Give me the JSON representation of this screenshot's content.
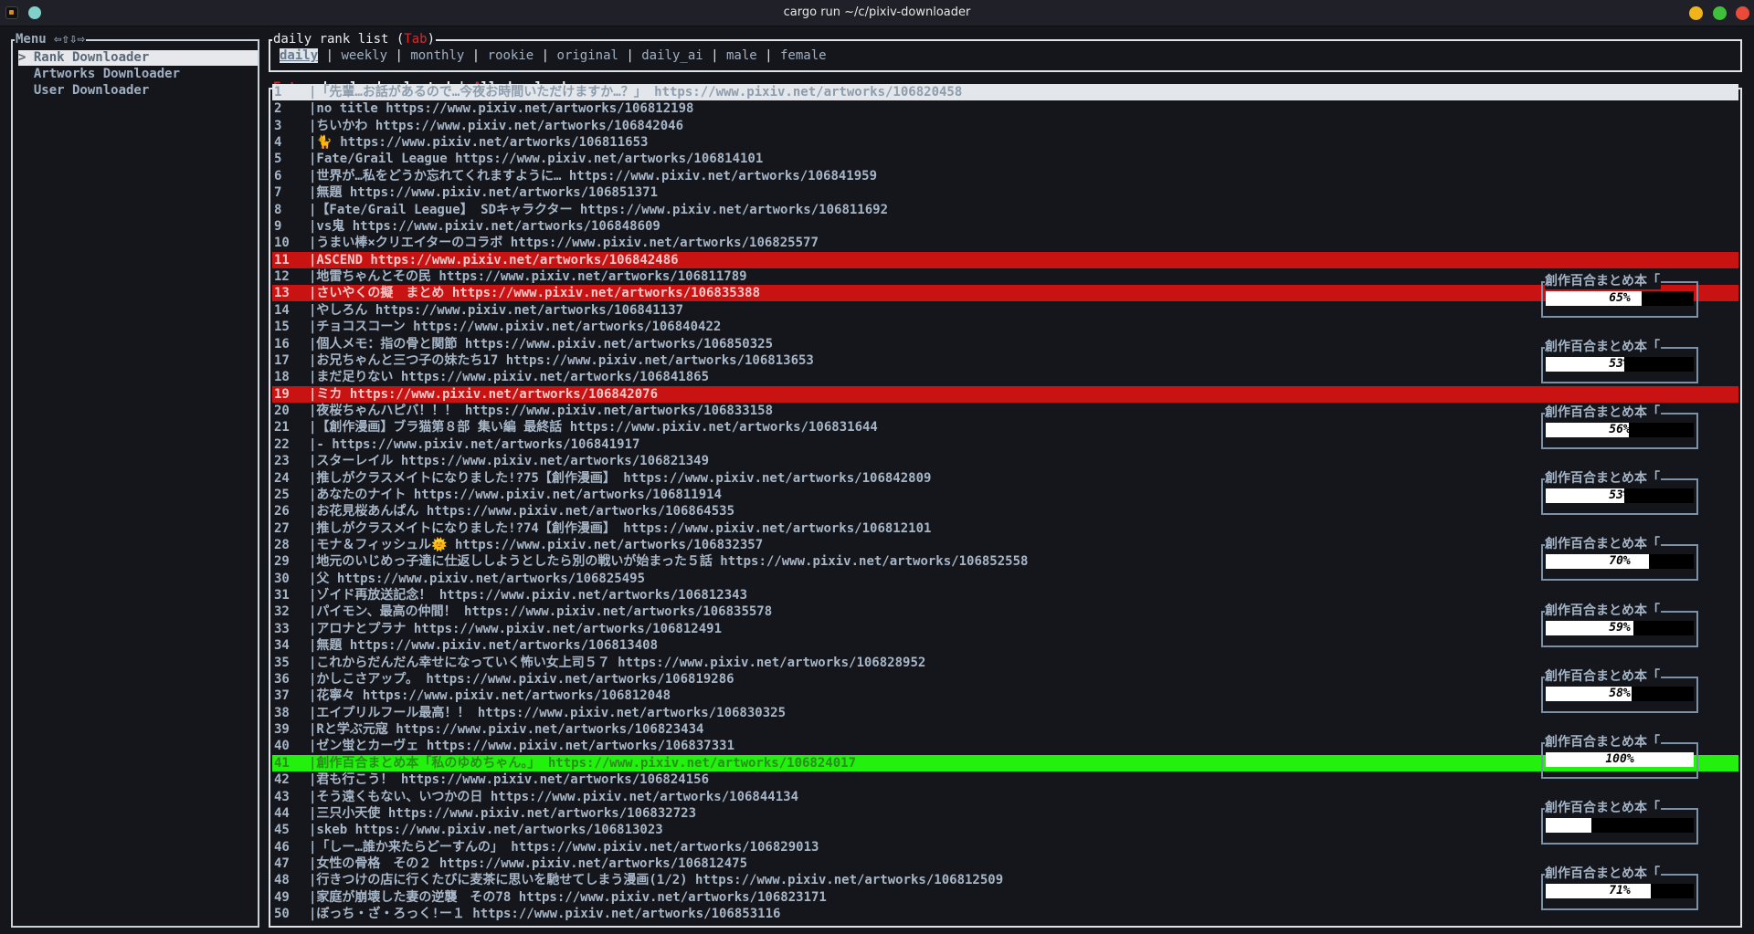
{
  "window": {
    "title": "cargo run ~/c/pixiv-downloader"
  },
  "menu": {
    "title": "Menu ⇦⇧⇩⇨",
    "items": [
      {
        "label": "> Rank Downloader",
        "selected": true
      },
      {
        "label": "  Artworks Downloader",
        "selected": false
      },
      {
        "label": "  User Downloader",
        "selected": false
      }
    ]
  },
  "tabs": {
    "title_prefix": "daily rank list (",
    "title_key": "Tab",
    "title_suffix": ")",
    "items": [
      "daily",
      "weekly",
      "monthly",
      "rookie",
      "original",
      "daily_ai",
      "male",
      "female"
    ],
    "active": 0,
    "separator": " | "
  },
  "list": {
    "title_key1": "Enter",
    "title_mid": " download selected | ",
    "title_key2": "A",
    "title_end": "ll download",
    "rows": [
      {
        "num": "1",
        "text": "|「先輩…お話があるので…今夜お時間いただけますか…？」 https://www.pixiv.net/artworks/106820458",
        "state": "selected"
      },
      {
        "num": "2",
        "text": "|no title https://www.pixiv.net/artworks/106812198",
        "state": ""
      },
      {
        "num": "3",
        "text": "|ちいかわ https://www.pixiv.net/artworks/106842046",
        "state": ""
      },
      {
        "num": "4",
        "text": "|🐈 https://www.pixiv.net/artworks/106811653",
        "state": ""
      },
      {
        "num": "5",
        "text": "|Fate/Grail League https://www.pixiv.net/artworks/106814101",
        "state": ""
      },
      {
        "num": "6",
        "text": "|世界が…私をどうか忘れてくれますように… https://www.pixiv.net/artworks/106841959",
        "state": ""
      },
      {
        "num": "7",
        "text": "|無題 https://www.pixiv.net/artworks/106851371",
        "state": ""
      },
      {
        "num": "8",
        "text": "|【Fate/Grail League】 SDキャラクター https://www.pixiv.net/artworks/106811692",
        "state": ""
      },
      {
        "num": "9",
        "text": "|vs鬼 https://www.pixiv.net/artworks/106848609",
        "state": ""
      },
      {
        "num": "10",
        "text": "|うまい棒×クリエイターのコラボ https://www.pixiv.net/artworks/106825577",
        "state": ""
      },
      {
        "num": "11",
        "text": "|ASCEND https://www.pixiv.net/artworks/106842486",
        "state": "failed"
      },
      {
        "num": "12",
        "text": "|地雷ちゃんとその民 https://www.pixiv.net/artworks/106811789",
        "state": ""
      },
      {
        "num": "13",
        "text": "|さいやくの擬　まとめ https://www.pixiv.net/artworks/106835388",
        "state": "failed"
      },
      {
        "num": "14",
        "text": "|やしろん https://www.pixiv.net/artworks/106841137",
        "state": ""
      },
      {
        "num": "15",
        "text": "|チョコスコーン https://www.pixiv.net/artworks/106840422",
        "state": ""
      },
      {
        "num": "16",
        "text": "|個人メモ：指の骨と関節 https://www.pixiv.net/artworks/106850325",
        "state": ""
      },
      {
        "num": "17",
        "text": "|お兄ちゃんと三つ子の妹たち17 https://www.pixiv.net/artworks/106813653",
        "state": ""
      },
      {
        "num": "18",
        "text": "|まだ足りない https://www.pixiv.net/artworks/106841865",
        "state": ""
      },
      {
        "num": "19",
        "text": "|ミカ https://www.pixiv.net/artworks/106842076",
        "state": "failed"
      },
      {
        "num": "20",
        "text": "|夜桜ちゃんハピバ！！！ https://www.pixiv.net/artworks/106833158",
        "state": ""
      },
      {
        "num": "21",
        "text": "|【創作漫画】ブラ猫第８部 集い編 最終話 https://www.pixiv.net/artworks/106831644",
        "state": ""
      },
      {
        "num": "22",
        "text": "|- https://www.pixiv.net/artworks/106841917",
        "state": ""
      },
      {
        "num": "23",
        "text": "|スターレイル https://www.pixiv.net/artworks/106821349",
        "state": ""
      },
      {
        "num": "24",
        "text": "|推しがクラスメイトになりました!?75【創作漫画】 https://www.pixiv.net/artworks/106842809",
        "state": ""
      },
      {
        "num": "25",
        "text": "|あなたのナイト https://www.pixiv.net/artworks/106811914",
        "state": ""
      },
      {
        "num": "26",
        "text": "|お花見桜あんぱん https://www.pixiv.net/artworks/106864535",
        "state": ""
      },
      {
        "num": "27",
        "text": "|推しがクラスメイトになりました!?74【創作漫画】 https://www.pixiv.net/artworks/106812101",
        "state": ""
      },
      {
        "num": "28",
        "text": "|モナ＆フィッシュル🌞 https://www.pixiv.net/artworks/106832357",
        "state": ""
      },
      {
        "num": "29",
        "text": "|地元のいじめっ子達に仕返ししようとしたら別の戦いが始まった５話 https://www.pixiv.net/artworks/106852558",
        "state": ""
      },
      {
        "num": "30",
        "text": "|父 https://www.pixiv.net/artworks/106825495",
        "state": ""
      },
      {
        "num": "31",
        "text": "|ゾイド再放送記念！ https://www.pixiv.net/artworks/106812343",
        "state": ""
      },
      {
        "num": "32",
        "text": "|パイモン、最高の仲間！ https://www.pixiv.net/artworks/106835578",
        "state": ""
      },
      {
        "num": "33",
        "text": "|アロナとプラナ https://www.pixiv.net/artworks/106812491",
        "state": ""
      },
      {
        "num": "34",
        "text": "|無題 https://www.pixiv.net/artworks/106813408",
        "state": ""
      },
      {
        "num": "35",
        "text": "|これからだんだん幸せになっていく怖い女上司５７ https://www.pixiv.net/artworks/106828952",
        "state": ""
      },
      {
        "num": "36",
        "text": "|かしこさアップ。 https://www.pixiv.net/artworks/106819286",
        "state": ""
      },
      {
        "num": "37",
        "text": "|花寧々 https://www.pixiv.net/artworks/106812048",
        "state": ""
      },
      {
        "num": "38",
        "text": "|エイプリルフール最高！！ https://www.pixiv.net/artworks/106830325",
        "state": ""
      },
      {
        "num": "39",
        "text": "|Rと学ぶ元寇 https://www.pixiv.net/artworks/106823434",
        "state": ""
      },
      {
        "num": "40",
        "text": "|ゼン蛍とカーヴェ https://www.pixiv.net/artworks/106837331",
        "state": ""
      },
      {
        "num": "41",
        "text": "|創作百合まとめ本「私のゆめちゃん。」 https://www.pixiv.net/artworks/106824017",
        "state": "done"
      },
      {
        "num": "42",
        "text": "|君も行こう！ https://www.pixiv.net/artworks/106824156",
        "state": ""
      },
      {
        "num": "43",
        "text": "|そう遠くもない、いつかの日 https://www.pixiv.net/artworks/106844134",
        "state": ""
      },
      {
        "num": "44",
        "text": "|三只小天使 https://www.pixiv.net/artworks/106832723",
        "state": ""
      },
      {
        "num": "45",
        "text": "|skeb https://www.pixiv.net/artworks/106813023",
        "state": ""
      },
      {
        "num": "46",
        "text": "|「しー…誰か来たらどーすんの」 https://www.pixiv.net/artworks/106829013",
        "state": ""
      },
      {
        "num": "47",
        "text": "|女性の骨格　その２ https://www.pixiv.net/artworks/106812475",
        "state": ""
      },
      {
        "num": "48",
        "text": "|行きつけの店に行くたびに麦茶に思いを馳せてしまう漫画(1/2) https://www.pixiv.net/artworks/106812509",
        "state": ""
      },
      {
        "num": "49",
        "text": "|家庭が崩壊した妻の逆襲　その78 https://www.pixiv.net/artworks/106823171",
        "state": ""
      },
      {
        "num": "50",
        "text": "|ぼっち・ざ・ろっく!ー１ https://www.pixiv.net/artworks/106853116",
        "state": ""
      }
    ]
  },
  "downloads": [
    {
      "title": "創作百合まとめ本「",
      "percent": 65,
      "label": "65%"
    },
    {
      "title": "創作百合まとめ本「",
      "percent": 53,
      "label": "53%"
    },
    {
      "title": "創作百合まとめ本「",
      "percent": 56,
      "label": "56%"
    },
    {
      "title": "創作百合まとめ本「",
      "percent": 53,
      "label": "53%"
    },
    {
      "title": "創作百合まとめ本「",
      "percent": 70,
      "label": "70%"
    },
    {
      "title": "創作百合まとめ本「",
      "percent": 59,
      "label": "59%"
    },
    {
      "title": "創作百合まとめ本「",
      "percent": 58,
      "label": "58%"
    },
    {
      "title": "創作百合まとめ本「",
      "percent": 100,
      "label": "100%"
    },
    {
      "title": "創作百合まとめ本「",
      "percent": 31,
      "label": "31%"
    },
    {
      "title": "創作百合まとめ本「",
      "percent": 71,
      "label": "71%"
    }
  ],
  "colors": {
    "failed_row": "#c91212",
    "done_row": "#21f10c",
    "selected_row": "#e3e6ea",
    "hotkey": "#e0262a"
  }
}
